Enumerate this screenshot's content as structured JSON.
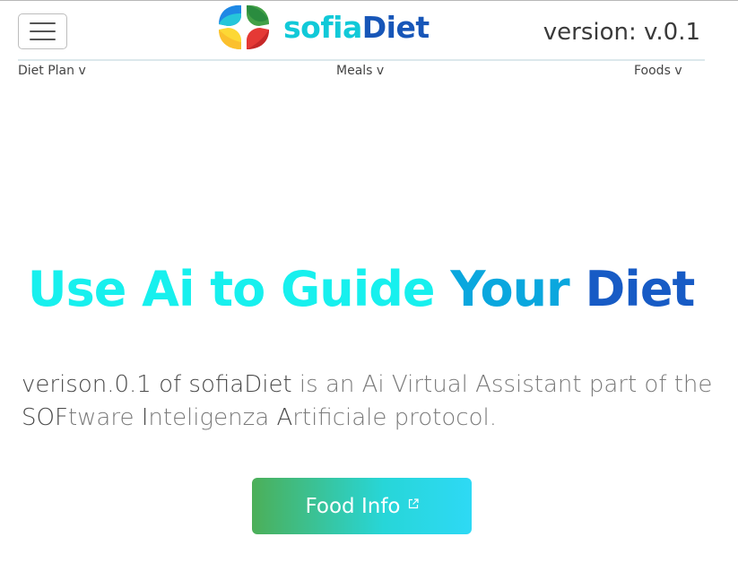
{
  "header": {
    "menu_icon": "hamburger-icon",
    "brand_part1": "sofia",
    "brand_part2": "Diet",
    "version_label": "version: v.0.1"
  },
  "nav": {
    "items": [
      {
        "label": "Diet Plan v"
      },
      {
        "label": "Meals v"
      },
      {
        "label": "Foods v"
      }
    ]
  },
  "hero": {
    "title_part1": "Use Ai to Guide",
    "title_part2": "Your",
    "title_part3": "Diet",
    "desc_dark1": "verison.0.1 of sofiaDiet",
    "desc_light1": " is an Ai Virtual Assistant part of the ",
    "desc_dark2": "SOF",
    "desc_light2": "tware ",
    "desc_dark3": "I",
    "desc_light3": "nteligenza ",
    "desc_dark4": "A",
    "desc_light4": "rtificiale protocol.",
    "cta_label": "Food Info",
    "cta_icon": "external-link-icon"
  },
  "colors": {
    "brand_cyan": "#11c9d8",
    "brand_blue": "#1756b8",
    "title_cyan": "#17f0ee",
    "title_mid": "#0aa7de",
    "title_blue": "#175bc5",
    "cta_start": "#4caf58",
    "cta_end": "#2ed9f5"
  }
}
